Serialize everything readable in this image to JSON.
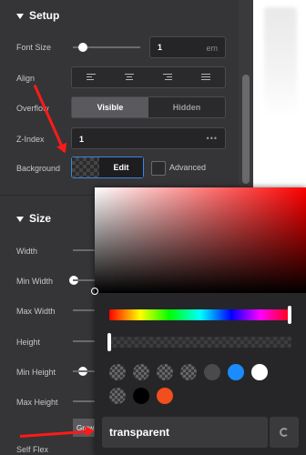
{
  "setup": {
    "title": "Setup",
    "font_size": {
      "label": "Font Size",
      "value": "1",
      "unit": "em",
      "slider_fraction": 0.2
    },
    "align": {
      "label": "Align",
      "options": [
        "left",
        "center",
        "right",
        "justify"
      ]
    },
    "overflow": {
      "label": "Overflow",
      "options": [
        "Visible",
        "Hidden"
      ],
      "selected": "Visible"
    },
    "z_index": {
      "label": "Z-Index",
      "value": "1",
      "more": "•••"
    },
    "background": {
      "label": "Background",
      "edit_label": "Edit",
      "advanced_label": "Advanced"
    }
  },
  "size": {
    "title": "Size",
    "fields": [
      "Width",
      "Min Width",
      "Max Width",
      "Height",
      "Min Height",
      "Max Height",
      "Self Flex"
    ],
    "grow_tab": "Grow"
  },
  "color_picker": {
    "hue": "#ff0000",
    "hex_value": "transparent",
    "presets": [
      "transparent",
      "transparent",
      "transparent",
      "transparent",
      "#4a4a4c",
      "#1a8cff",
      "#ffffff",
      "transparent",
      "#000000",
      "#f24e1e"
    ]
  },
  "colors": {
    "accent": "#3a86e0",
    "annotation": "#ff1a1a"
  }
}
